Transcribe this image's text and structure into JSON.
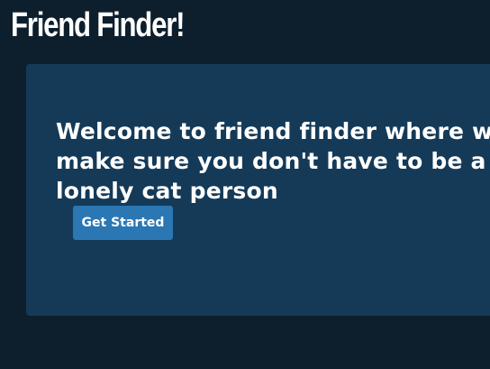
{
  "header": {
    "title": "Friend Finder!"
  },
  "hero": {
    "text": "Welcome to friend finder where we make sure you don't have to be a lonely cat person",
    "button_label": "Get Started"
  },
  "colors": {
    "background": "#0d1f2d",
    "card": "#143a58",
    "button": "#2a77b4",
    "text": "#ffffff"
  }
}
